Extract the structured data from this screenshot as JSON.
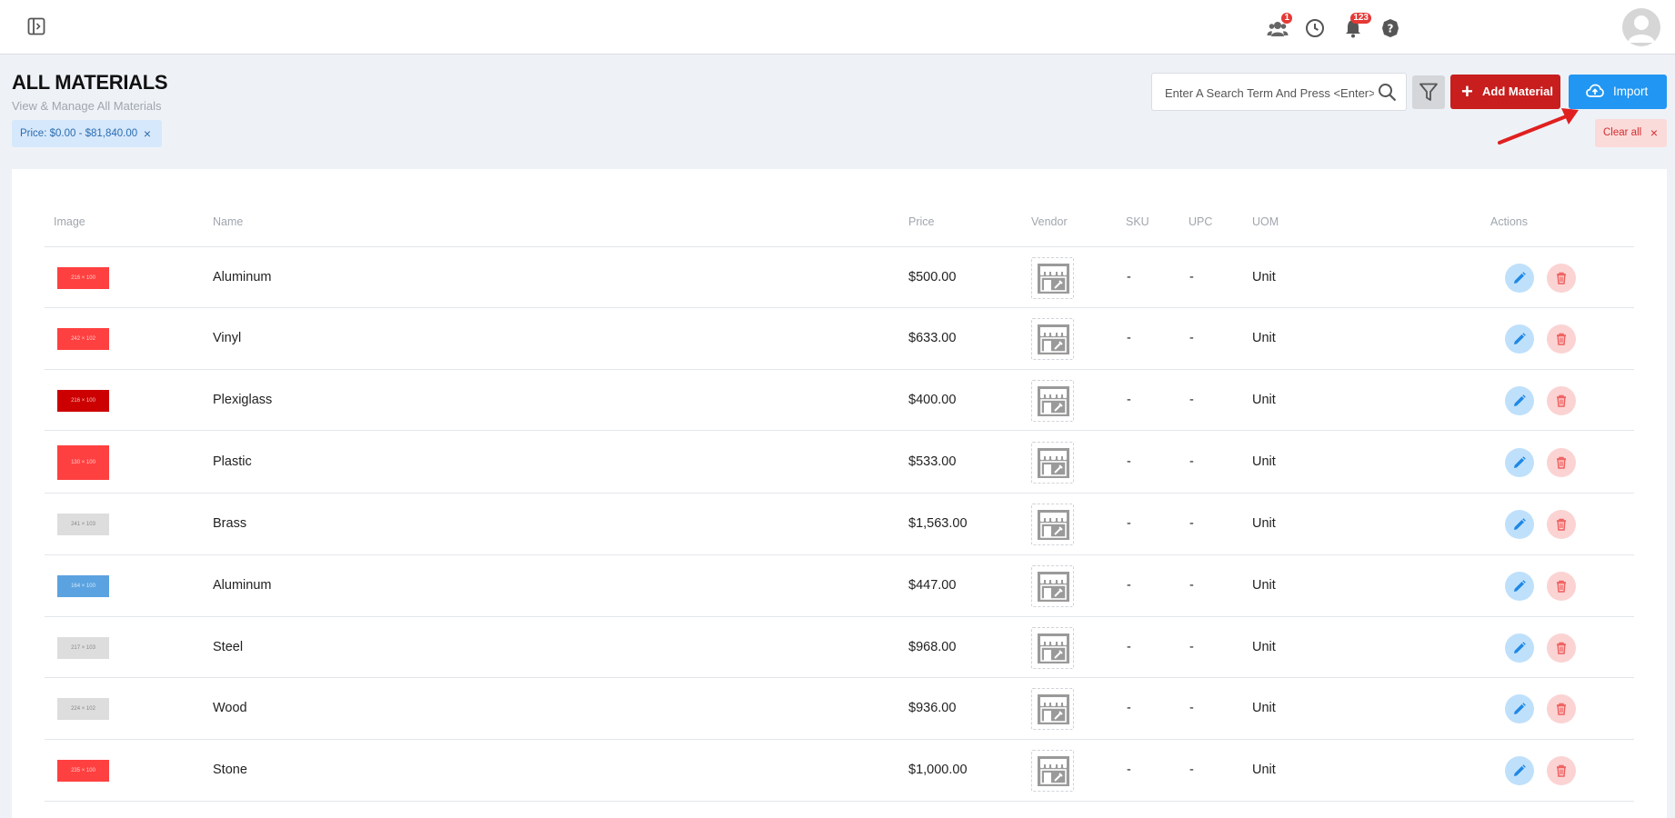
{
  "header": {
    "notifications_badges": {
      "team": "1",
      "bell": "123"
    }
  },
  "page": {
    "title": "ALL MATERIALS",
    "subtitle": "View & Manage All Materials",
    "filter_chip": "Price: $0.00 - $81,840.00",
    "chip_close": "×"
  },
  "toolbar": {
    "search_placeholder": "Enter A Search Term And Press <Enter>",
    "add_label": "Add Material",
    "add_plus": "+",
    "import_label": "Import",
    "clear_label": "Clear all",
    "clear_x": "×"
  },
  "colors": {
    "add_button": "#c81e1e",
    "import_button": "#2196f3",
    "annotation_arrow": "#e02020"
  },
  "table": {
    "columns": [
      "Image",
      "Name",
      "Price",
      "Vendor",
      "SKU",
      "UPC",
      "UOM",
      "Actions"
    ],
    "rows": [
      {
        "thumb_color": "#ff4040",
        "thumb_text": "216 × 100",
        "name": "Aluminum",
        "price": "$500.00",
        "sku": "-",
        "upc": "-",
        "uom": "Unit"
      },
      {
        "thumb_color": "#ff4040",
        "thumb_text": "242 × 102",
        "name": "Vinyl",
        "price": "$633.00",
        "sku": "-",
        "upc": "-",
        "uom": "Unit"
      },
      {
        "thumb_color": "#cc0000",
        "thumb_text": "216 × 100",
        "name": "Plexiglass",
        "price": "$400.00",
        "sku": "-",
        "upc": "-",
        "uom": "Unit"
      },
      {
        "thumb_color": "#ff4040",
        "thumb_text": "130 × 100",
        "name": "Plastic",
        "price": "$533.00",
        "sku": "-",
        "upc": "-",
        "uom": "Unit"
      },
      {
        "thumb_color": "#dddddd",
        "thumb_text": "241 × 103",
        "name": "Brass",
        "price": "$1,563.00",
        "sku": "-",
        "upc": "-",
        "uom": "Unit"
      },
      {
        "thumb_color": "#5ba3e0",
        "thumb_text": "164 × 100",
        "name": "Aluminum",
        "price": "$447.00",
        "sku": "-",
        "upc": "-",
        "uom": "Unit"
      },
      {
        "thumb_color": "#dddddd",
        "thumb_text": "217 × 103",
        "name": "Steel",
        "price": "$968.00",
        "sku": "-",
        "upc": "-",
        "uom": "Unit"
      },
      {
        "thumb_color": "#dddddd",
        "thumb_text": "224 × 102",
        "name": "Wood",
        "price": "$936.00",
        "sku": "-",
        "upc": "-",
        "uom": "Unit"
      },
      {
        "thumb_color": "#ff4040",
        "thumb_text": "235 × 100",
        "name": "Stone",
        "price": "$1,000.00",
        "sku": "-",
        "upc": "-",
        "uom": "Unit"
      }
    ]
  },
  "icons": {
    "sidebar_toggle": "sidebar-toggle-icon",
    "team": "team-icon",
    "clock": "clock-icon",
    "bell": "bell-icon",
    "help": "help-icon",
    "search": "search-icon",
    "filter": "filter-icon",
    "import": "cloud-upload-icon",
    "vendor": "store-placeholder-icon",
    "edit": "pencil-icon",
    "delete": "trash-icon"
  }
}
